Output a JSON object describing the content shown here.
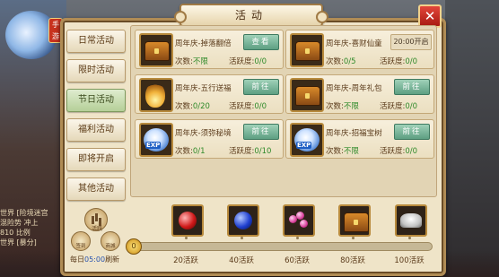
{
  "background": {
    "logo_badge": "手游",
    "side_lines": [
      "世界 [险境迷宫",
      "混险势 冲上",
      "810 比例",
      "世界 [暴分]"
    ]
  },
  "window": {
    "title": "活动",
    "close_label": "✕"
  },
  "sidebar": {
    "items": [
      {
        "label": "日常活动",
        "active": false
      },
      {
        "label": "限时活动",
        "active": false
      },
      {
        "label": "节日活动",
        "active": true
      },
      {
        "label": "福利活动",
        "active": false
      },
      {
        "label": "即将开启",
        "active": false
      },
      {
        "label": "其他活动",
        "active": false
      }
    ]
  },
  "activities": [
    {
      "name": "周年庆-掉落翻倍",
      "count_label": "次数:",
      "count_value": "不限",
      "act_label": "活跃度:",
      "act_value": "0/0",
      "button": "查看",
      "time": "",
      "icon": "chest-icon"
    },
    {
      "name": "周年庆-喜财仙童",
      "count_label": "次数:",
      "count_value": "0/5",
      "act_label": "活跃度:",
      "act_value": "0/0",
      "button": "",
      "time": "20:00开启",
      "icon": "chest-icon"
    },
    {
      "name": "周年庆-五行送福",
      "count_label": "次数:",
      "count_value": "0/20",
      "act_label": "活跃度:",
      "act_value": "0/0",
      "button": "前往",
      "time": "",
      "icon": "flame-icon"
    },
    {
      "name": "周年庆-周年礼包",
      "count_label": "次数:",
      "count_value": "不限",
      "act_label": "活跃度:",
      "act_value": "0/0",
      "button": "前往",
      "time": "",
      "icon": "chest-icon"
    },
    {
      "name": "周年庆-须弥秘境",
      "count_label": "次数:",
      "count_value": "0/1",
      "act_label": "活跃度:",
      "act_value": "0/10",
      "button": "前往",
      "time": "",
      "icon": "exp-orb-icon"
    },
    {
      "name": "周年庆-招福宝树",
      "count_label": "次数:",
      "count_value": "不限",
      "act_label": "活跃度:",
      "act_value": "0/0",
      "button": "前往",
      "time": "",
      "icon": "exp-orb-icon"
    }
  ],
  "exp_label": "EXP",
  "activity_panel": {
    "chart_icon_label": "活跃",
    "mini_icon_1": "签到",
    "mini_icon_2": "商城",
    "refresh_prefix": "每日",
    "refresh_time": "05:00",
    "refresh_suffix": "刷新",
    "current_points": "0",
    "progress_fraction": 0.0,
    "rewards": [
      {
        "label": "20活跃",
        "icon": "red-orb-icon"
      },
      {
        "label": "40活跃",
        "icon": "blue-orb-icon"
      },
      {
        "label": "60活跃",
        "icon": "pink-gems-icon"
      },
      {
        "label": "80活跃",
        "icon": "chest-icon"
      },
      {
        "label": "100活跃",
        "icon": "silver-ingot-icon"
      }
    ]
  }
}
